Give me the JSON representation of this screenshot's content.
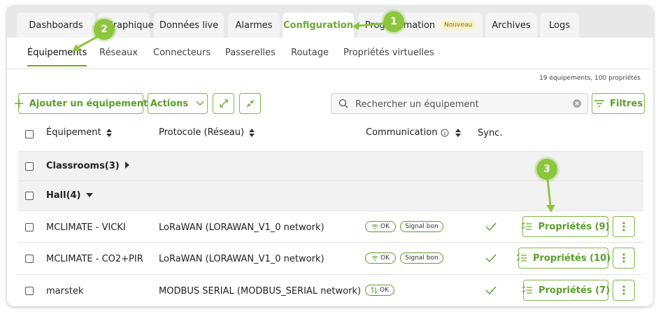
{
  "tabs": [
    {
      "label": "Dashboards"
    },
    {
      "label": "Graphiques"
    },
    {
      "label": "Données live"
    },
    {
      "label": "Alarmes"
    },
    {
      "label": "Configuration"
    },
    {
      "label": "Programmation",
      "badge": "Nouveau"
    },
    {
      "label": "Archives"
    },
    {
      "label": "Logs"
    }
  ],
  "subtabs": [
    "Équipements",
    "Réseaux",
    "Connecteurs",
    "Passerelles",
    "Routage",
    "Propriétés virtuelles"
  ],
  "summary": "19 équipements, 100 propriétés",
  "toolbar": {
    "add_label": "Ajouter un équipement",
    "actions_label": "Actions",
    "search_placeholder": "Rechercher un équipement",
    "filters_label": "Filtres"
  },
  "columns": {
    "equipment": "Équipement",
    "protocol": "Protocole (Réseau)",
    "communication": "Communication",
    "sync": "Sync."
  },
  "groups": [
    {
      "label": "Classrooms(3)",
      "state": "collapsed"
    },
    {
      "label": "Hall(4)",
      "state": "expanded"
    }
  ],
  "rows": [
    {
      "name": "MCLIMATE - VICKI",
      "protocol": "LoRaWAN (LORAWAN_V1_0 network)",
      "status": "OK",
      "status_icon": "wifi-icon",
      "signal": "Signal bon",
      "props": "Propriétés (9)"
    },
    {
      "name": "MCLIMATE - CO2+PIR",
      "protocol": "LoRaWAN (LORAWAN_V1_0 network)",
      "status": "OK",
      "status_icon": "wifi-icon",
      "signal": "Signal bon",
      "props": "Propriétés (10)"
    },
    {
      "name": "marstek",
      "protocol": "MODBUS SERIAL (MODBUS_SERIAL network)",
      "status": "OK",
      "status_icon": "transfer-icon",
      "props": "Propriétés (7)"
    }
  ],
  "annotations": [
    "1",
    "2",
    "3"
  ],
  "colors": {
    "accent": "#6aab2e",
    "annotation": "#8cc63f"
  }
}
